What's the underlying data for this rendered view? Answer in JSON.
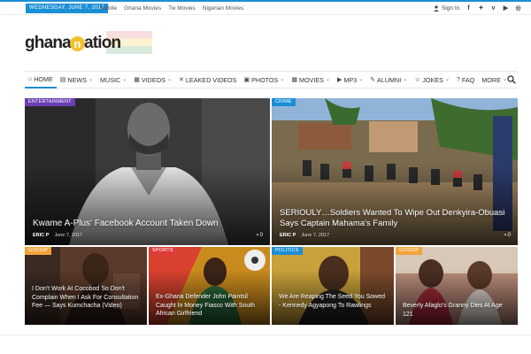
{
  "topbar": {
    "date": "WEDNESDAY, JUNE 7, 2017",
    "links": [
      "Mobile",
      "Ghana Movies",
      "Tw Movies",
      "Nigerian Movies"
    ],
    "signin": "Sign In",
    "socials": [
      "facebook-icon",
      "twitter-icon",
      "vimeo-icon",
      "youtube-icon",
      "instagram-icon"
    ]
  },
  "logo": {
    "part1": "ghana",
    "n": "n",
    "part2": "ation"
  },
  "nav": [
    {
      "label": "HOME",
      "icon": "home-icon",
      "chevron": false,
      "active": true
    },
    {
      "label": "NEWS",
      "icon": "newspaper-icon",
      "chevron": true
    },
    {
      "label": "MUSIC",
      "icon": "",
      "chevron": true
    },
    {
      "label": "VIDEOS",
      "icon": "film-icon",
      "chevron": true
    },
    {
      "label": "LEAKED VIDEOS",
      "icon": "expand-icon",
      "chevron": false
    },
    {
      "label": "PHOTOS",
      "icon": "image-icon",
      "chevron": true
    },
    {
      "label": "MOVIES",
      "icon": "film-icon",
      "chevron": true
    },
    {
      "label": "MP3",
      "icon": "play-icon",
      "chevron": true
    },
    {
      "label": "ALUMNI",
      "icon": "edit-icon",
      "chevron": true
    },
    {
      "label": "JOKES",
      "icon": "smile-icon",
      "chevron": true
    },
    {
      "label": "FAQ",
      "icon": "question-icon",
      "chevron": false
    },
    {
      "label": "MORE",
      "icon": "",
      "chevron": true
    }
  ],
  "tiles": [
    {
      "tag": "ENTERTAINMENT",
      "tag_color": "#6a3fb4",
      "title": "Kwame A-Plus' Facebook Account Taken Down",
      "author": "ERIC P",
      "date": "June 7, 2017",
      "comments": "0"
    },
    {
      "tag": "CRIME",
      "tag_color": "#1a8fd6",
      "title": "SERIOULY…Soldiers Wanted To Wipe Out Denkyira-Obuasi Says Captain Mahama's Family",
      "author": "ERIC P",
      "date": "June 7, 2017",
      "comments": "0"
    },
    {
      "tag": "GOSSIP",
      "tag_color": "#f2a33a",
      "title": "I Don't Work At Cocobod So Don't Complain When I Ask For Consultation Fee — Says Kumchacha (Video)"
    },
    {
      "tag": "SPORTS",
      "tag_color": "#e03b3b",
      "title": "Ex-Ghana Defender John Paintsil Caught In Money Fiasco With South African Girlfriend"
    },
    {
      "tag": "POLITICS",
      "tag_color": "#1a8fd6",
      "title": "We Are Reaping The Seed You Sowed - Kennedy Agyapong To Rawlings"
    },
    {
      "tag": "GOSSIP",
      "tag_color": "#f2a33a",
      "title": "Beverly Afaglo's Granny Dies At Age 121"
    }
  ]
}
